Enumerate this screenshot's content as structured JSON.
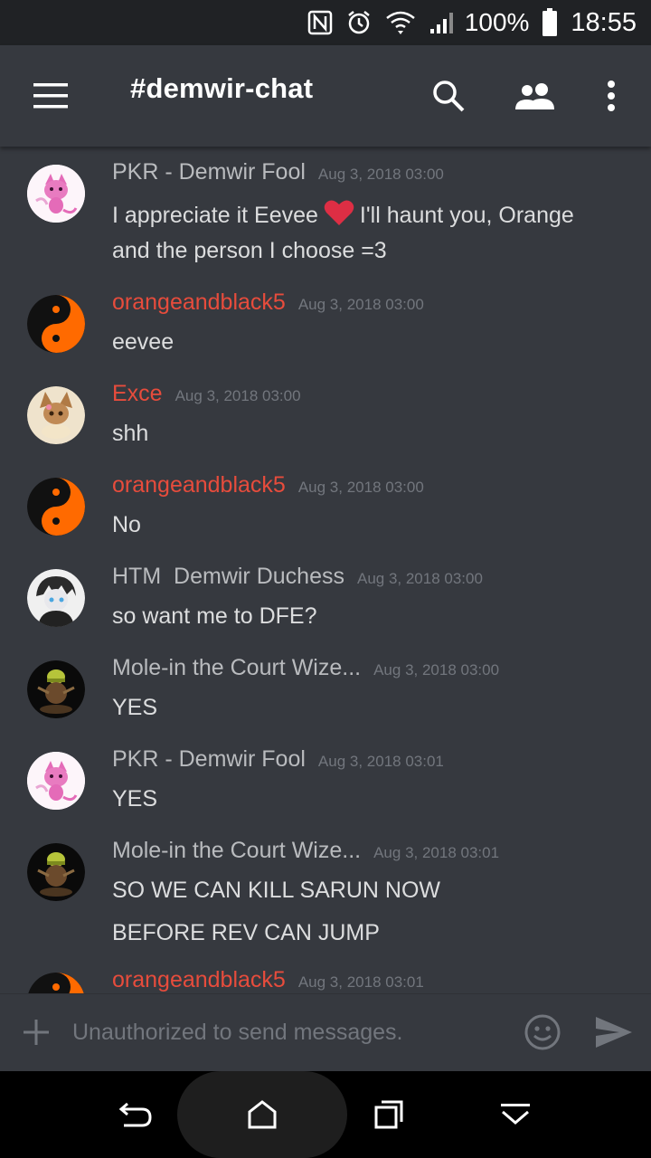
{
  "status_bar": {
    "battery_percent": "100%",
    "time": "18:55",
    "icons": [
      "nfc-icon",
      "alarm-icon",
      "wifi-icon",
      "signal-icon",
      "battery-icon"
    ]
  },
  "app_bar": {
    "channel_title": "#demwir-chat",
    "icons": [
      "menu-icon",
      "search-icon",
      "members-icon",
      "more-icon"
    ]
  },
  "messages": [
    {
      "author": "PKR - Demwir Fool",
      "author_color": "#b9bbbe",
      "timestamp": "Aug 3, 2018 03:00",
      "lines": [
        "I appreciate it Eevee",
        "I'll haunt you, Orange",
        "and the person I choose =3"
      ]
    },
    {
      "author": "orangeandblack5",
      "author_color": "#e74c3c",
      "timestamp": "Aug 3, 2018 03:00",
      "lines": [
        "eevee"
      ]
    },
    {
      "author": "Exce",
      "author_color": "#e74c3c",
      "timestamp": "Aug 3, 2018 03:00",
      "lines": [
        "shh"
      ]
    },
    {
      "author": "orangeandblack5",
      "author_color": "#e74c3c",
      "timestamp": "Aug 3, 2018 03:00",
      "lines": [
        "No"
      ]
    },
    {
      "author": "HTM  Demwir Duchess",
      "author_color": "#b9bbbe",
      "timestamp": "Aug 3, 2018 03:00",
      "lines": [
        "so want me to DFE?"
      ]
    },
    {
      "author": "Mole-in the Court Wize...",
      "author_color": "#b9bbbe",
      "timestamp": "Aug 3, 2018 03:00",
      "lines": [
        "YES"
      ]
    },
    {
      "author": "PKR - Demwir Fool",
      "author_color": "#b9bbbe",
      "timestamp": "Aug 3, 2018 03:01",
      "lines": [
        "YES"
      ]
    },
    {
      "author": "Mole-in the Court Wize...",
      "author_color": "#b9bbbe",
      "timestamp": "Aug 3, 2018 03:01",
      "lines": [
        "SO WE CAN KILL SARUN NOW",
        "BEFORE REV CAN JUMP"
      ]
    },
    {
      "author": "orangeandblack5",
      "author_color": "#e74c3c",
      "timestamp": "Aug 3, 2018 03:01",
      "lines": []
    }
  ],
  "composer": {
    "placeholder": "Unauthorized to send messages.",
    "icons": [
      "add-icon",
      "emoji-icon",
      "send-icon"
    ]
  },
  "nav_bar": {
    "icons": [
      "back-icon",
      "home-icon",
      "recents-icon",
      "collapse-icon"
    ]
  }
}
